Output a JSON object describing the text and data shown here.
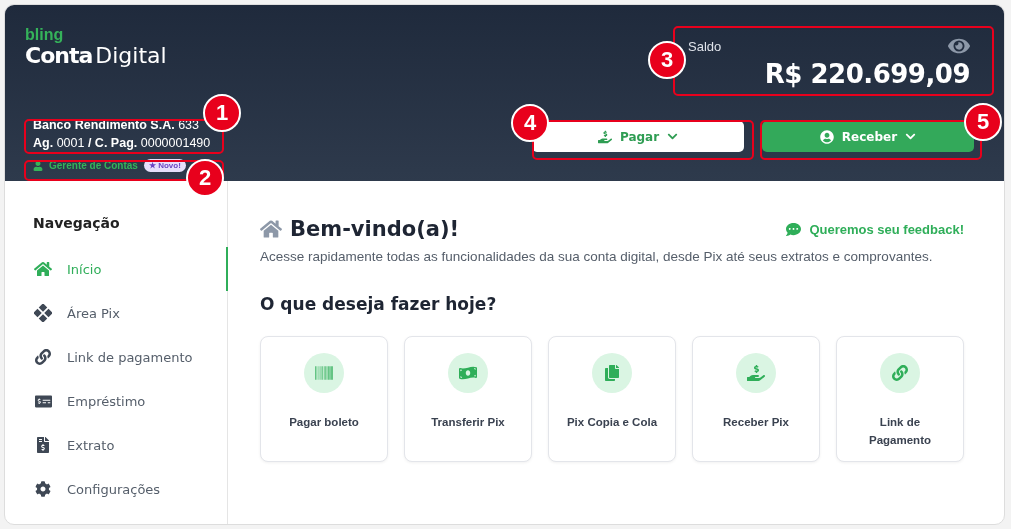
{
  "logo": {
    "brand": "bling",
    "product_bold": "Conta",
    "product_light": "Digital"
  },
  "account": {
    "bank": "Banco Rendimento S.A.",
    "bank_code": "633",
    "agency_label": "Ag.",
    "agency": "0001",
    "account_label": "/ C. Pag.",
    "account": "0000001490"
  },
  "manager": {
    "label": "Gerente de Contas",
    "badge": "★ Novo!"
  },
  "balance": {
    "label": "Saldo",
    "value": "R$ 220.699,09"
  },
  "actions": [
    {
      "label": "Pagar",
      "kind": "outline"
    },
    {
      "label": "Receber",
      "kind": "filled"
    }
  ],
  "sidebar": {
    "title": "Navegação",
    "items": [
      {
        "label": "Início",
        "selected": true
      },
      {
        "label": "Área Pix",
        "selected": false
      },
      {
        "label": "Link de pagamento",
        "selected": false
      },
      {
        "label": "Empréstimo",
        "selected": false
      },
      {
        "label": "Extrato",
        "selected": false
      },
      {
        "label": "Configurações",
        "selected": false
      }
    ]
  },
  "welcome": {
    "title": "Bem-vindo(a)!",
    "feedback": "Queremos seu feedback!",
    "subtitle": "Acesse rapidamente todas as funcionalidades da sua conta digital, desde Pix até seus extratos e comprovantes."
  },
  "quick_actions": {
    "title": "O que deseja fazer hoje?",
    "cards": [
      {
        "label": "Pagar boleto"
      },
      {
        "label": "Transferir Pix"
      },
      {
        "label": "Pix Copia e Cola"
      },
      {
        "label": "Receber Pix"
      },
      {
        "label": "Link de Pagamento"
      }
    ]
  },
  "callouts": [
    "1",
    "2",
    "3",
    "4",
    "5"
  ]
}
